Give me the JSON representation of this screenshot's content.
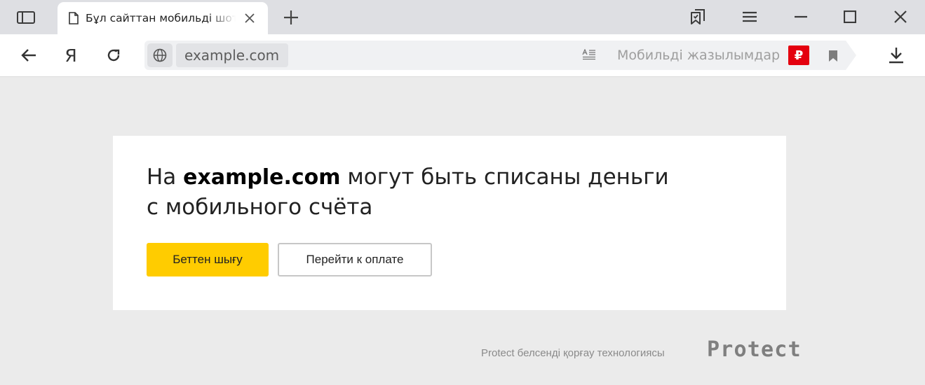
{
  "tab": {
    "title": "Бұл сайттан мобильді шоттан ақша алынуы мүмкін"
  },
  "omnibox": {
    "url": "example.com",
    "mobile_subscriptions": "Мобильді жазылымдар",
    "ruble_symbol": "₽"
  },
  "toolbar": {
    "home_glyph": "Я"
  },
  "warning": {
    "prefix": "На ",
    "domain": "example.com",
    "middle": " могут  быть списаны деньги",
    "line2": "с мобильного счёта"
  },
  "buttons": {
    "leave_label": "Беттен шығу",
    "pay_label": "Перейти к оплате"
  },
  "footer": {
    "protect_note": "Protect белсенді қорғау технологиясы",
    "protect_logo": "Protect"
  },
  "colors": {
    "accent_yellow": "#ffcc00",
    "ruble_red": "#e4000f",
    "background": "#ebebeb"
  },
  "icons": {
    "sidebar": "sidebar-icon",
    "tab_page": "document-icon",
    "tab_close": "close-icon",
    "new_tab": "plus-icon",
    "collections": "bookmarks-icon",
    "menu": "hamburger-icon",
    "minimize": "minimize-icon",
    "maximize": "maximize-icon",
    "close_window": "close-icon",
    "back": "arrow-left-icon",
    "reload": "reload-icon",
    "site_info": "globe-icon",
    "reader": "reader-icon",
    "bookmark": "bookmark-icon",
    "download": "download-icon"
  }
}
